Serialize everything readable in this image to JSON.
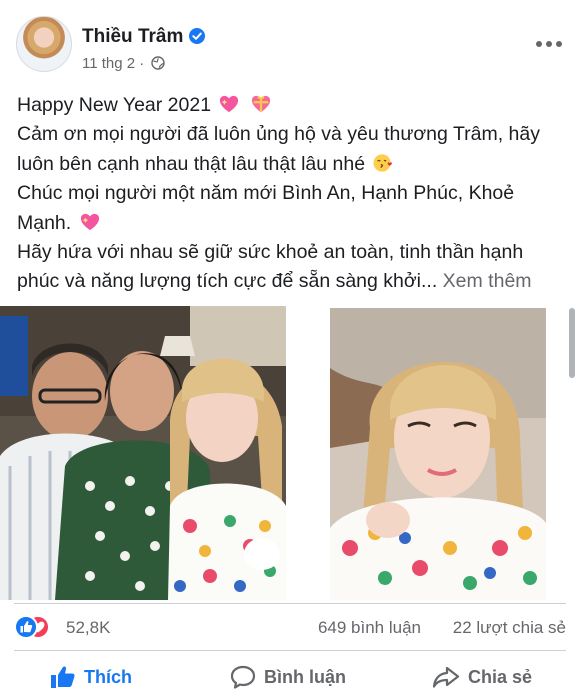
{
  "post": {
    "author": "Thiều Trâm",
    "timestamp": "11 thg 2",
    "separator": "·",
    "verified": true,
    "privacy_icon": "globe-icon",
    "lines": {
      "line1": "Happy New Year 2021",
      "line2": "Cảm ơn mọi người đã luôn ủng hộ và yêu thương Trâm, hãy luôn bên cạnh nhau thật lâu thật lâu nhé",
      "line3": "Chúc mọi người một năm mới Bình An, Hạnh Phúc, Khoẻ Mạnh.",
      "line4": "Hãy hứa với nhau sẽ giữ sức khoẻ an toàn, tinh thần hạnh phúc và năng lượng tích cực để sẵn sàng khởi..."
    },
    "see_more": "Xem thêm",
    "emojis": [
      "sparkling-heart-emoji",
      "heart-with-ribbon-emoji",
      "face-blowing-kiss-emoji",
      "sparkling-heart-emoji"
    ]
  },
  "stats": {
    "reactions": "52,8K",
    "comments": "649 bình luận",
    "shares": "22 lượt chia sẻ"
  },
  "actions": {
    "like": "Thích",
    "comment": "Bình luận",
    "share": "Chia sẻ"
  },
  "colors": {
    "accent": "#1877f2",
    "text": "#1c1e21",
    "secondary_text": "#65676b",
    "love": "#f33e58"
  }
}
